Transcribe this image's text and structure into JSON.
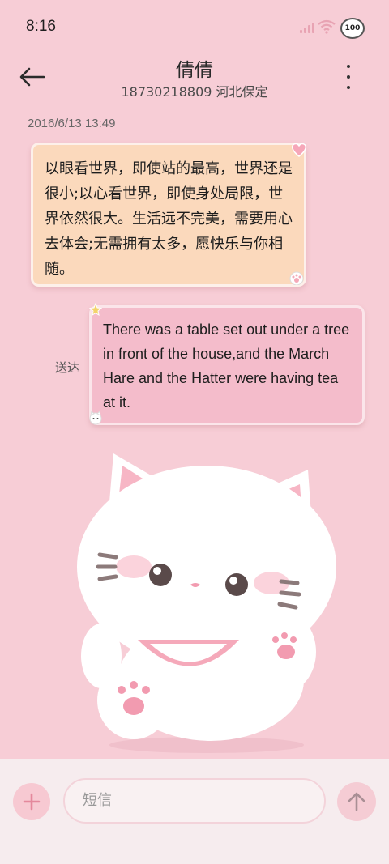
{
  "status_bar": {
    "time": "8:16",
    "battery": "100"
  },
  "header": {
    "contact_name": "倩倩",
    "contact_info": "18730218809 河北保定"
  },
  "conversation": {
    "timestamp": "2016/6/13 13:49",
    "incoming_message": "以眼看世界，即使站的最高，世界还是很小;以心看世界，即使身处局限，世界依然很大。生活远不完美，需要用心去体会;无需拥有太多，愿快乐与你相随。",
    "outgoing_message": "There was a table set out under a tree in front of the house,and the March Hare and the Hatter were having tea at it.",
    "outgoing_status": "送达"
  },
  "composer": {
    "placeholder": "短信"
  },
  "colors": {
    "background": "#f7cdd6",
    "incoming_bubble": "#fbd9bc",
    "outgoing_bubble": "#f4bccb",
    "accent": "#e4889c"
  },
  "icons": [
    "back-arrow-icon",
    "more-vert-icon",
    "plus-icon",
    "send-arrow-icon",
    "signal-icon",
    "wifi-icon",
    "battery-icon"
  ]
}
